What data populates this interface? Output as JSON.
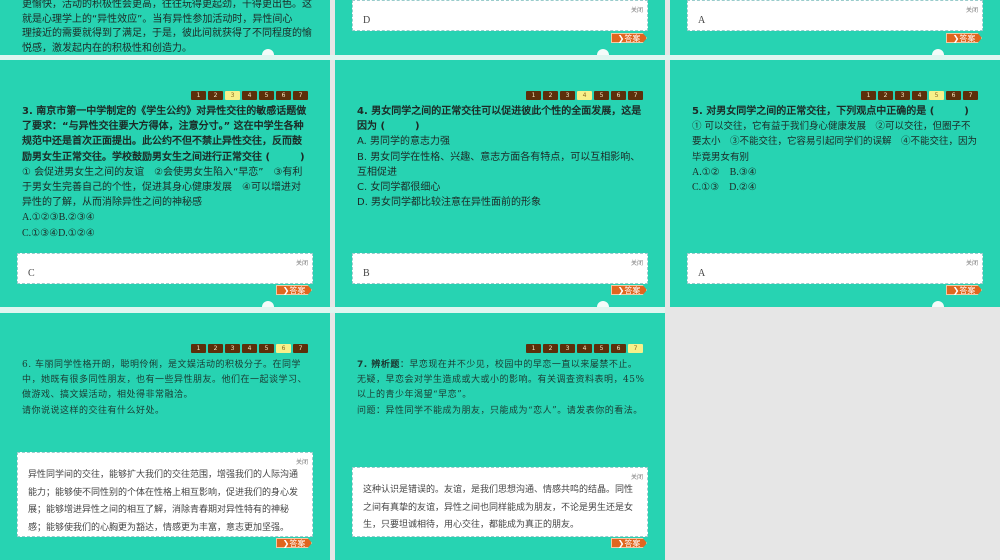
{
  "colors": {
    "slide_bg": "#27d3b2",
    "nav_active": "#f7f08a",
    "nav_inactive": "#5c2f0a",
    "answer_button": "#e0661f"
  },
  "common": {
    "close_label": "关闭",
    "answer_button_label": "❯答案",
    "nav_pages": [
      "1",
      "2",
      "3",
      "4",
      "5",
      "6",
      "7"
    ]
  },
  "top_row": {
    "slide1_text": [
      "更愉快，活动的积极性会更高，往往玩得更起劲，干得更出色。这",
      "就是心理学上的“异性效应”。当有异性参加活动时，异性间心",
      "理接近的需要就得到了满足，于是，彼此间就获得了不同程度的愉",
      "悦感，激发起内在的积极性和创造力。"
    ],
    "slide2_answer": "D",
    "slide3_answer": "A"
  },
  "slides": [
    {
      "number": "3",
      "question": "3. 南京市第一中学制定的《学生公约》对异性交往的敏感话题做了要求：“与异性交往要大方得体，注意分寸。” 这在中学生各种规范中还是首次正面提出。此公约不但不禁止异性交往，反而鼓励男女生正常交往。学校鼓励男女生之间进行正常交往 (　　　)",
      "options": [
        "① 会促进男女生之间的友谊　②会使男女生陷入“早恋”　③有利于男女生完善自己的个性，促进其身心健康发展　④可以增进对异性的了解，从而消除异性之间的神秘感",
        "A.①②③B.②③④",
        "C.①③④D.①②④"
      ],
      "answer": "C"
    },
    {
      "number": "4",
      "question": "4. 男女同学之间的正常交往可以促进彼此个性的全面发展，这是因为 (　　　)",
      "options": [
        "A. 男同学的意志力强",
        "B. 男女同学在性格、兴趣、意志方面各有特点，可以互相影响、互相促进",
        "C. 女同学都很细心",
        "D. 男女同学都比较注意在异性面前的形象"
      ],
      "answer": "B"
    },
    {
      "number": "5",
      "question": "5. 对男女同学之间的正常交往，下列观点中正确的是 (　　　)",
      "options": [
        "① 可以交往，它有益于我们身心健康发展　②可以交往，但圈子不要太小　③不能交往，它容易引起同学们的误解　④不能交往，因为毕竟男女有别",
        "A.①②　B.③④",
        "C.①③　D.②④"
      ],
      "answer": "A"
    },
    {
      "number": "6",
      "question": "6. 车丽同学性格开朗，聪明伶俐，是文娱活动的积极分子。在同学中，她既有很多同性朋友，也有一些异性朋友。他们在一起谈学习、做游戏、搞文娱活动，相处得非常融洽。",
      "options": [
        "请你说说这样的交往有什么好处。"
      ],
      "answer": "异性同学间的交往，能够扩大我们的交往范围，增强我们的人际沟通能力；能够使不同性别的个体在性格上相互影响，促进我们的身心发展；能够增进异性之间的相互了解，消除青春期对异性特有的神秘感；能够使我们的心胸更为豁达，情感更为丰富，意志更加坚强。"
    },
    {
      "number": "7",
      "question_label": "7. 辨析题",
      "question": "：早恋现在并不少见，校园中的早恋一直以来屡禁不止。无疑，早恋会对学生造成或大或小的影响。有关调查资料表明，45% 以上的青少年渴望“早恋”。",
      "options": [
        "问题：异性同学不能成为朋友，只能成为“恋人”。请发表你的看法。"
      ],
      "answer": "这种认识是错误的。友谊，是我们思想沟通、情感共鸣的结晶。同性之间有真挚的友谊，异性之间也同样能成为朋友，不论是男生还是女生，只要坦诚相待，用心交往，都能成为真正的朋友。"
    }
  ]
}
